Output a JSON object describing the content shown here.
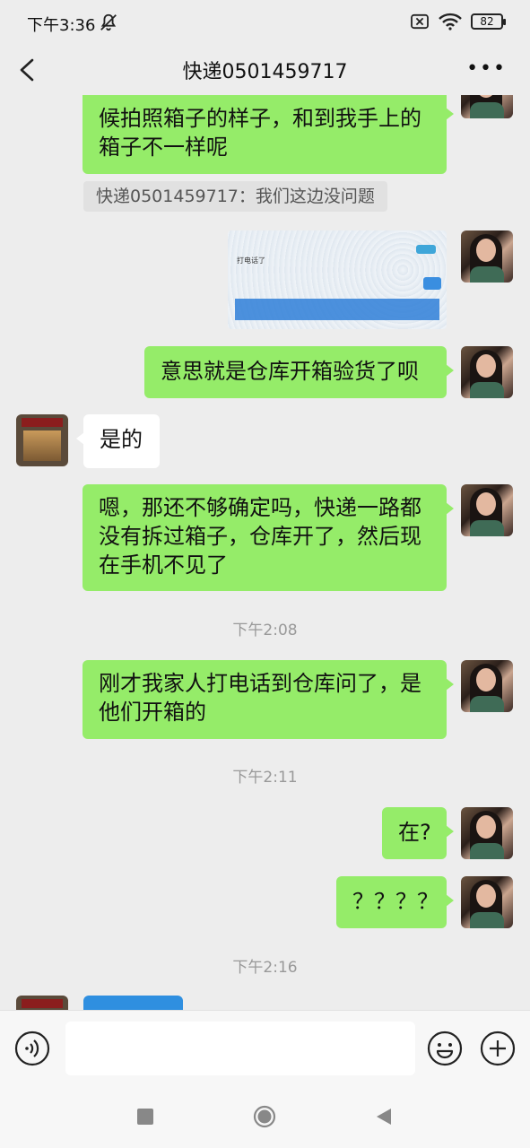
{
  "status_bar": {
    "time": "下午3:36",
    "battery": "82"
  },
  "header": {
    "title": "快递0501459717"
  },
  "messages": {
    "m1": "候拍照箱子的样子，和到我手上的箱子不一样呢",
    "quote": "快递0501459717：我们这边没问题",
    "image_text": "打电话了",
    "m3": "意思就是仓库开箱验货了呗",
    "m4": "是的",
    "m5": "嗯，那还不够确定吗，快递一路都没有拆过箱子，仓库开了，然后现在手机不见了",
    "ts1": "下午2:08",
    "m6": "刚才我家人打电话到仓库问了，是他们开箱的",
    "ts2": "下午2:11",
    "m7": "在?",
    "m8": "？？？？",
    "ts3": "下午2:16"
  },
  "icons": {
    "back": "back-arrow-icon",
    "more": "more-icon",
    "voice": "voice-icon",
    "emoji": "emoji-icon",
    "plus": "plus-icon"
  },
  "colors": {
    "sent_bubble": "#95ec69",
    "received_bubble": "#ffffff",
    "background": "#ededed"
  }
}
